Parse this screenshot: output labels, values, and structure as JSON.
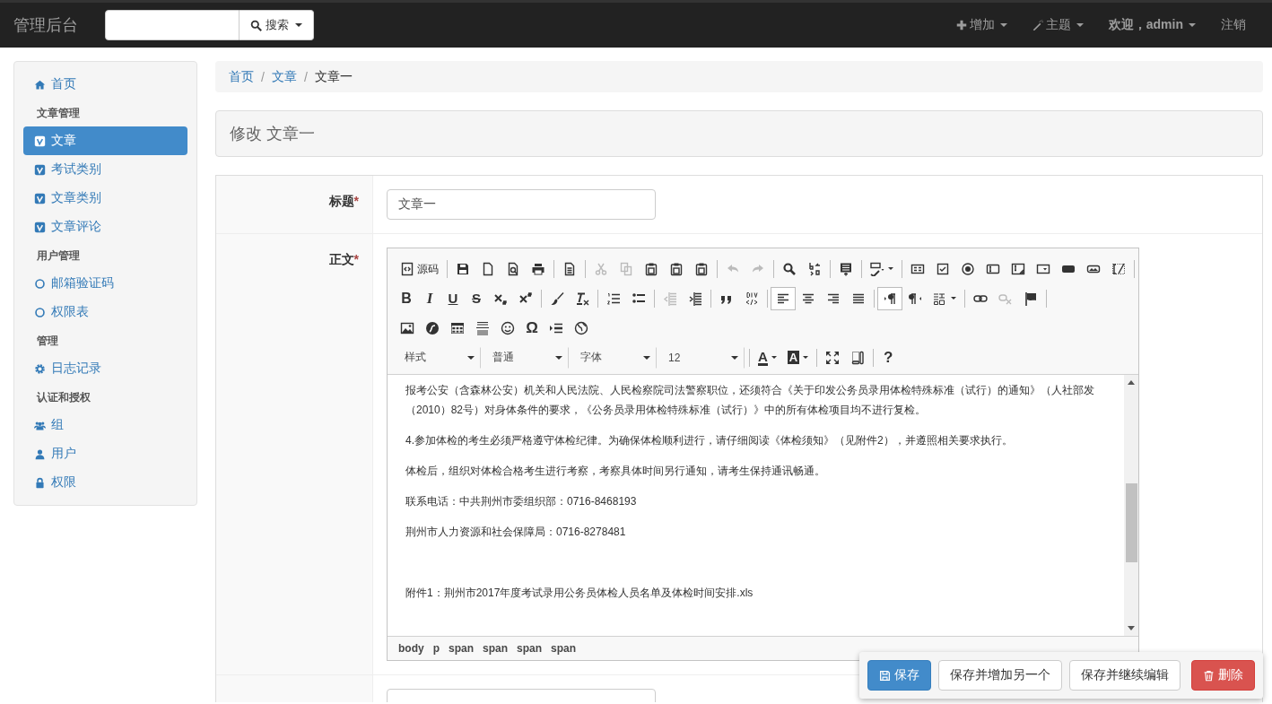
{
  "navbar": {
    "brand": "管理后台",
    "search_button": "搜索",
    "menus": [
      {
        "kind": "add",
        "label": "增加"
      },
      {
        "kind": "theme",
        "label": "主题"
      },
      {
        "kind": "user",
        "label": "欢迎，admin"
      },
      {
        "kind": "logout",
        "label": "注销"
      }
    ]
  },
  "sidebar": {
    "items": [
      {
        "kind": "link",
        "label": "首页",
        "selected": false
      },
      {
        "kind": "header",
        "label": "文章管理"
      },
      {
        "kind": "link",
        "label": "文章",
        "selected": true
      },
      {
        "kind": "link",
        "label": "考试类别",
        "selected": false
      },
      {
        "kind": "link",
        "label": "文章类别",
        "selected": false
      },
      {
        "kind": "link",
        "label": "文章评论",
        "selected": false
      },
      {
        "kind": "header",
        "label": "用户管理"
      },
      {
        "kind": "link",
        "label": "邮箱验证码",
        "selected": false
      },
      {
        "kind": "link",
        "label": "权限表",
        "selected": false
      },
      {
        "kind": "header",
        "label": "管理"
      },
      {
        "kind": "link",
        "label": "日志记录",
        "selected": false
      },
      {
        "kind": "header",
        "label": "认证和授权"
      },
      {
        "kind": "link",
        "label": "组",
        "selected": false
      },
      {
        "kind": "link",
        "label": "用户",
        "selected": false
      },
      {
        "kind": "link",
        "label": "权限",
        "selected": false
      }
    ]
  },
  "breadcrumb": [
    {
      "kind": "link",
      "label": "首页"
    },
    {
      "kind": "separator",
      "label": "/"
    },
    {
      "kind": "link",
      "label": "文章"
    },
    {
      "kind": "separator",
      "label": "/"
    },
    {
      "kind": "current",
      "label": "文章一"
    }
  ],
  "panel_title": "修改 文章一",
  "form": {
    "title_label": "标题",
    "required_mark": "*",
    "title_value": "文章一",
    "body_label": "正文",
    "body_required_mark": "*",
    "toolbar": [
      [
        [
          {
            "kind": "source",
            "label": "源码",
            "disabled": false,
            "on": false
          }
        ],
        [
          {
            "kind": "floppy",
            "disabled": false,
            "on": false
          },
          {
            "kind": "page",
            "disabled": false,
            "on": false
          },
          {
            "kind": "page-magnifier",
            "disabled": false,
            "on": false
          },
          {
            "kind": "printer",
            "disabled": false,
            "on": false
          }
        ],
        [
          {
            "kind": "template",
            "disabled": false,
            "on": false
          }
        ],
        [
          {
            "kind": "scissors",
            "disabled": true,
            "on": false
          },
          {
            "kind": "copy",
            "disabled": true,
            "on": false
          },
          {
            "kind": "clipboard",
            "disabled": false,
            "on": false
          },
          {
            "kind": "clipboard",
            "disabled": false,
            "on": false
          },
          {
            "kind": "clipboard",
            "disabled": false,
            "on": false
          }
        ],
        [
          {
            "kind": "undo",
            "disabled": true,
            "on": false
          },
          {
            "kind": "redo",
            "disabled": true,
            "on": false
          }
        ],
        [
          {
            "kind": "magnifier",
            "disabled": false,
            "on": false
          },
          {
            "kind": "replace",
            "disabled": false,
            "on": false
          }
        ],
        [
          {
            "kind": "select-all",
            "disabled": false,
            "on": false
          }
        ],
        [
          {
            "kind": "spellcheck",
            "disabled": false,
            "on": false
          }
        ],
        [
          {
            "kind": "form",
            "disabled": false,
            "on": false
          },
          {
            "kind": "checkbox",
            "disabled": false,
            "on": false
          },
          {
            "kind": "radio",
            "disabled": false,
            "on": false
          },
          {
            "kind": "text-field",
            "disabled": false,
            "on": false
          },
          {
            "kind": "textarea",
            "disabled": false,
            "on": false
          },
          {
            "kind": "select",
            "disabled": false,
            "on": false
          },
          {
            "kind": "solid-button",
            "disabled": false,
            "on": false
          },
          {
            "kind": "image-button",
            "disabled": false,
            "on": false
          },
          {
            "kind": "hidden-field",
            "disabled": false,
            "on": false
          }
        ]
      ],
      [
        [
          {
            "kind": "bold",
            "label": "B",
            "disabled": false,
            "on": false
          },
          {
            "kind": "italic",
            "label": "I",
            "disabled": false,
            "on": false
          },
          {
            "kind": "underline",
            "label": "U",
            "disabled": false,
            "on": false
          },
          {
            "kind": "strike",
            "label": "S",
            "disabled": false,
            "on": false
          },
          {
            "kind": "subscript",
            "disabled": false,
            "on": false
          },
          {
            "kind": "superscript",
            "disabled": false,
            "on": false
          }
        ],
        [
          {
            "kind": "paintbrush",
            "disabled": false,
            "on": false
          },
          {
            "kind": "remove-format",
            "disabled": false,
            "on": false
          }
        ],
        [
          {
            "kind": "numbered-list",
            "disabled": false,
            "on": false
          },
          {
            "kind": "bulleted-list",
            "disabled": false,
            "on": false
          }
        ],
        [
          {
            "kind": "outdent",
            "disabled": true,
            "on": false
          },
          {
            "kind": "indent",
            "disabled": false,
            "on": false
          }
        ],
        [
          {
            "kind": "quote",
            "disabled": false,
            "on": false
          },
          {
            "kind": "div",
            "disabled": false,
            "on": false
          }
        ],
        [
          {
            "kind": "align-left",
            "disabled": false,
            "on": true
          },
          {
            "kind": "align-center",
            "disabled": false,
            "on": false
          },
          {
            "kind": "align-right",
            "disabled": false,
            "on": false
          },
          {
            "kind": "justify",
            "disabled": false,
            "on": false
          }
        ],
        [
          {
            "kind": "pilcrow-right",
            "disabled": false,
            "on": true
          },
          {
            "kind": "pilcrow-left",
            "disabled": false,
            "on": false
          },
          {
            "kind": "language",
            "disabled": false,
            "on": false
          }
        ],
        [
          {
            "kind": "link",
            "disabled": false,
            "on": false
          },
          {
            "kind": "unlink",
            "disabled": true,
            "on": false
          },
          {
            "kind": "flag",
            "disabled": false,
            "on": false
          }
        ]
      ],
      [
        [
          {
            "kind": "picture",
            "disabled": false,
            "on": false
          },
          {
            "kind": "flash",
            "disabled": false,
            "on": false
          },
          {
            "kind": "table",
            "disabled": false,
            "on": false
          },
          {
            "kind": "horizontal-lines",
            "disabled": false,
            "on": false
          },
          {
            "kind": "smiley",
            "disabled": false,
            "on": false
          },
          {
            "kind": "omega",
            "label": "Ω",
            "disabled": false,
            "on": false
          },
          {
            "kind": "page-break",
            "disabled": false,
            "on": false
          },
          {
            "kind": "globe",
            "disabled": false,
            "on": false
          }
        ]
      ],
      [
        [
          {
            "kind": "combo",
            "label": "样式",
            "disabled": false,
            "on": false
          },
          {
            "kind": "combo",
            "label": "普通",
            "disabled": false,
            "on": false
          },
          {
            "kind": "combo",
            "label": "字体",
            "disabled": false,
            "on": false
          },
          {
            "kind": "combo",
            "label": "12",
            "disabled": false,
            "on": false
          }
        ],
        [
          {
            "kind": "text-color",
            "label": "A",
            "disabled": false,
            "on": false
          },
          {
            "kind": "bg-color",
            "label": "A",
            "disabled": false,
            "on": false
          }
        ],
        [
          {
            "kind": "maximize",
            "disabled": false,
            "on": false
          },
          {
            "kind": "show-blocks",
            "disabled": false,
            "on": false
          }
        ],
        [
          {
            "kind": "help",
            "label": "?",
            "disabled": false,
            "on": false
          }
        ]
      ]
    ],
    "content": [
      {
        "kind": "paragraph",
        "text": "报考公安（含森林公安）机关和人民法院、人民检察院司法警察职位，还须符合《关于印发公务员录用体检特殊标准（试行）的通知》（人社部发（2010）82号）对身体条件的要求，《公务员录用体检特殊标准（试行）》中的所有体检项目均不进行复检。"
      },
      {
        "kind": "paragraph",
        "text": "4.参加体检的考生必须严格遵守体检纪律。为确保体检顺利进行，请仔细阅读《体检须知》（见附件2），并遵照相关要求执行。"
      },
      {
        "kind": "paragraph",
        "text": "体检后，组织对体检合格考生进行考察，考察具体时间另行通知，请考生保持通讯畅通。"
      },
      {
        "kind": "paragraph",
        "text": "联系电话：中共荆州市委组织部：0716-8468193"
      },
      {
        "kind": "paragraph",
        "text": "荆州市人力资源和社会保障局：0716-8278481"
      },
      {
        "kind": "blank"
      },
      {
        "kind": "paragraph",
        "text": "附件1：荆州市2017年度考试录用公务员体检人员名单及体检时间安排.xls"
      }
    ],
    "path": [
      "body",
      "p",
      "span",
      "span",
      "span",
      "span"
    ]
  },
  "actions": [
    {
      "kind": "primary",
      "label": "保存"
    },
    {
      "kind": "default",
      "label": "保存并增加另一个"
    },
    {
      "kind": "default",
      "label": "保存并继续编辑"
    },
    {
      "kind": "danger",
      "label": "删除"
    }
  ]
}
